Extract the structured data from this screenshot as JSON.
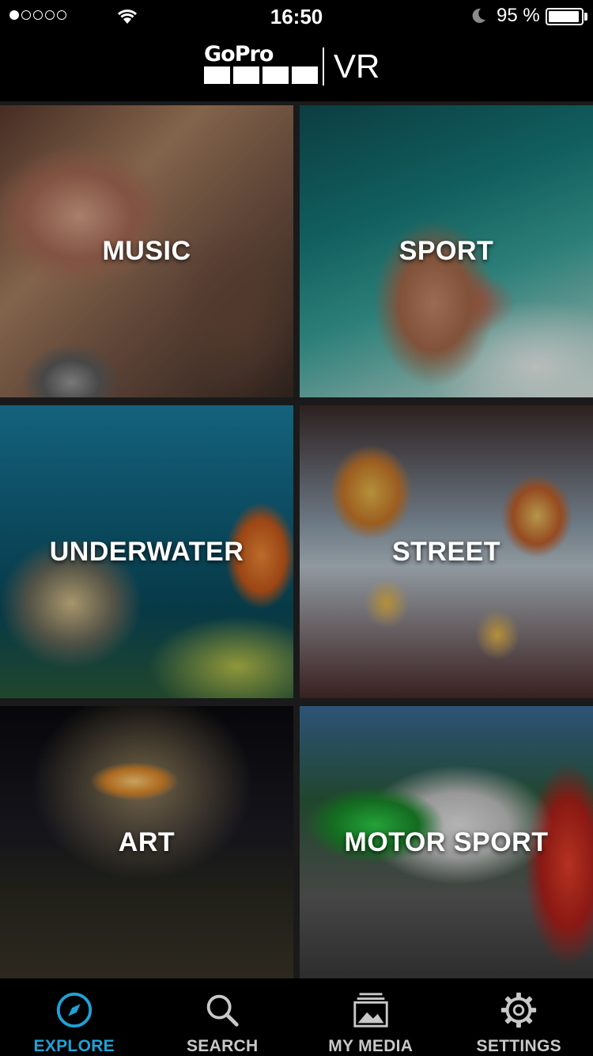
{
  "status_bar": {
    "time": "16:50",
    "battery_percent": "95 %",
    "battery_level": 0.95,
    "signal_bars_filled": 1,
    "signal_bars_total": 5
  },
  "header": {
    "logo_word": "GoPro",
    "logo_suffix": "VR"
  },
  "categories": [
    {
      "label": "MUSIC"
    },
    {
      "label": "SPORT"
    },
    {
      "label": "UNDERWATER"
    },
    {
      "label": "STREET"
    },
    {
      "label": "ART"
    },
    {
      "label": "MOTOR SPORT"
    }
  ],
  "tab_bar": {
    "accent_color": "#1fa2d6",
    "tabs": [
      {
        "label": "EXPLORE",
        "icon": "compass-icon",
        "active": true
      },
      {
        "label": "SEARCH",
        "icon": "search-icon",
        "active": false
      },
      {
        "label": "MY MEDIA",
        "icon": "media-library-icon",
        "active": false
      },
      {
        "label": "SETTINGS",
        "icon": "gear-icon",
        "active": false
      }
    ]
  }
}
